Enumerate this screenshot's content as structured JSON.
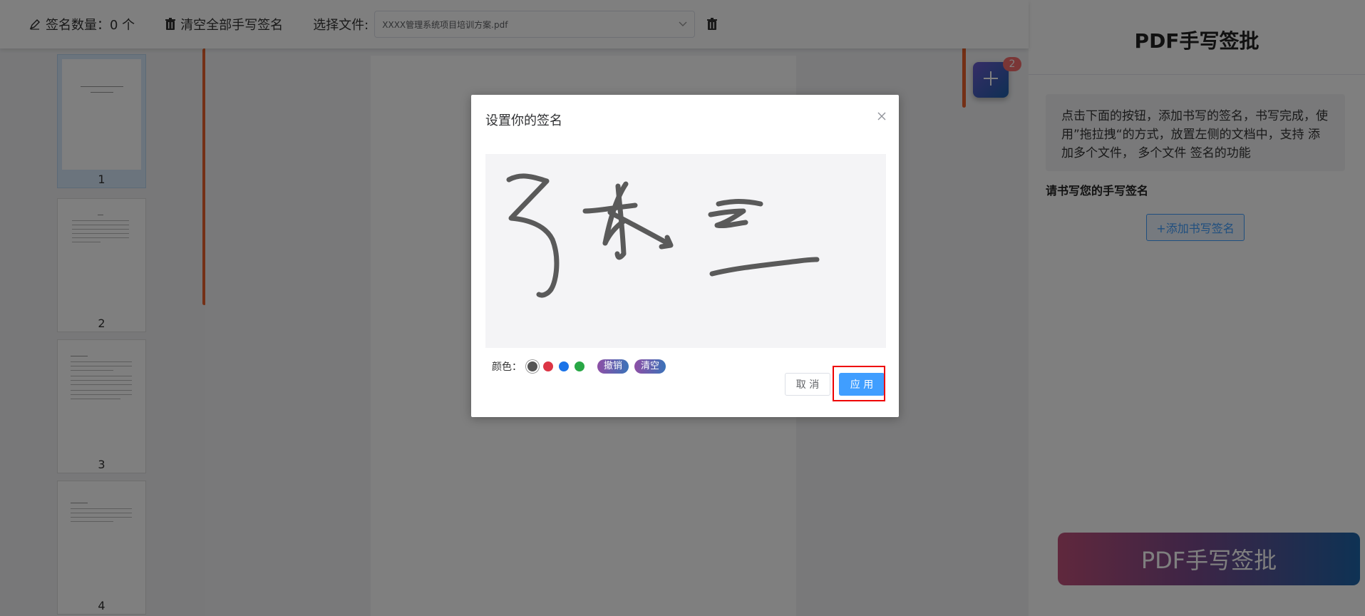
{
  "toolbar": {
    "signature_count_label": "签名数量：0 个",
    "clear_all_label": "清空全部手写签名",
    "select_file_label": "选择文件:",
    "selected_file": "XXXX管理系统项目培训方案.pdf"
  },
  "thumbnails": [
    {
      "number": "1",
      "selected": true
    },
    {
      "number": "2",
      "selected": false
    },
    {
      "number": "3",
      "selected": false
    },
    {
      "number": "4",
      "selected": false
    }
  ],
  "fab": {
    "badge": "2"
  },
  "right_panel": {
    "title": "PDF手写签批",
    "description": "点击下面的按钮，添加书写的签名，书写完成，使用”拖拉拽“的方式，放置左侧的文档中，支持 添加多个文件， 多个文件 签名的功能",
    "section_label": "请书写您的手写签名",
    "add_button": "+添加书写签名",
    "banner": "PDF手写签批"
  },
  "modal": {
    "title": "设置你的签名",
    "color_label": "颜色：",
    "colors": [
      "#555555",
      "#dc3545",
      "#1a73e8",
      "#28a745"
    ],
    "undo_label": "撤销",
    "clear_label": "清空",
    "cancel_label": "取 消",
    "apply_label": "应 用"
  },
  "colors": {
    "primary": "#409eff",
    "accent": "#e8612c",
    "badge": "#f56c6c"
  }
}
